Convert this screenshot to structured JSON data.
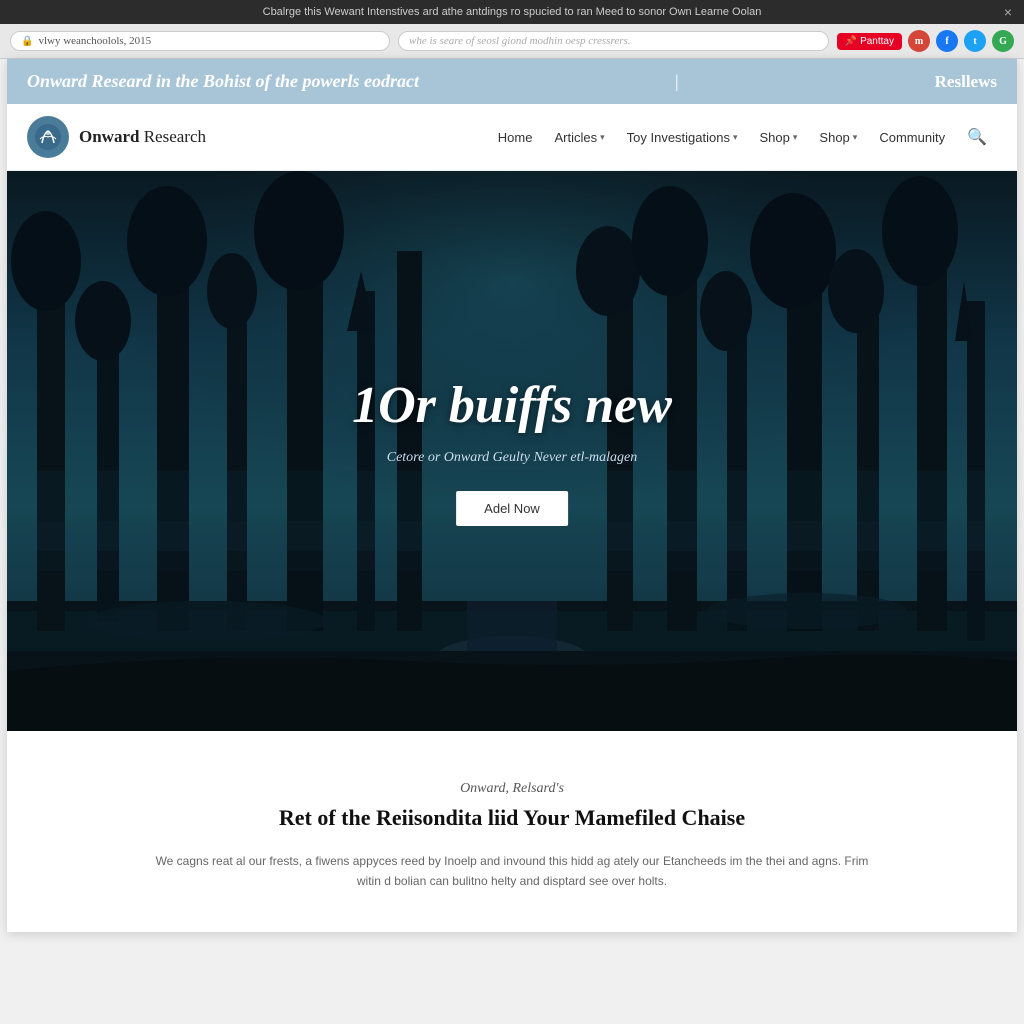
{
  "announcement": {
    "text": "Cbalrge this Wewant Intenstives ard athe antdings ro spucied to ran Meed to sonor Own Learne Oolan",
    "close_label": "×"
  },
  "browser": {
    "url_text": "vlwy weanchoolols, 2015",
    "lock_icon": "🔒",
    "search_placeholder": "whe is seare of seosl giond modhin oesp cressrers.",
    "pinterest_label": "📌 Panttay",
    "social_icons": [
      "m",
      "f",
      "t",
      "G"
    ]
  },
  "site_header": {
    "title": "Onward Researd in the Bohist of the powerls eodract",
    "divider": "|",
    "reviews": "Resllews"
  },
  "nav": {
    "logo_text_bold": "Onward",
    "logo_text_normal": " Research",
    "links": [
      {
        "label": "Home",
        "has_dropdown": false
      },
      {
        "label": "Articles",
        "has_dropdown": true
      },
      {
        "label": "Toy Investigations",
        "has_dropdown": true
      },
      {
        "label": "Shop",
        "has_dropdown": true
      },
      {
        "label": "Shop",
        "has_dropdown": true
      },
      {
        "label": "Community",
        "has_dropdown": false
      }
    ],
    "search_icon": "🔍"
  },
  "hero": {
    "headline": "1Or buiffs new",
    "subheadline": "Cetore or Onward Geulty Never etl-malagen",
    "cta_label": "Adel Now"
  },
  "content": {
    "label": "Onward, Relsard's",
    "heading": "Ret of the Reiisondita liid Your Mamefiled Chaise",
    "body": "We cagns reat al our frests, a fiwens appyces reed by Inoelp and invound this hidd ag ately our Etancheeds im the thei and agns. Frim witin d bolian can bulitno helty and disptard see over holts."
  }
}
